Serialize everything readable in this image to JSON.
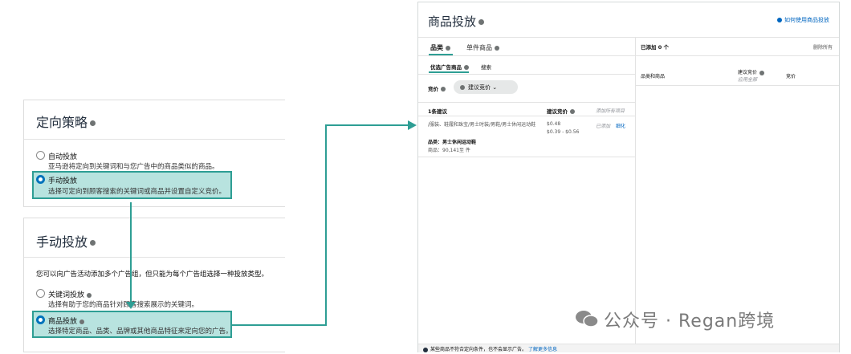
{
  "strategy_panel": {
    "title": "定向策略",
    "options": [
      {
        "label": "自动投放",
        "desc": "亚马逊将定向到关键词和与您广告中的商品类似的商品。",
        "selected": false
      },
      {
        "label": "手动投放",
        "desc": "选择可定向到顾客搜索的关键词或商品并设置自定义竞价。",
        "selected": true
      }
    ]
  },
  "manual_panel": {
    "title": "手动投放",
    "intro": "您可以向广告活动添加多个广告组，但只能为每个广告组选择一种投放类型。",
    "options": [
      {
        "label": "关键词投放",
        "desc": "选择有助于您的商品针对顾客搜索展示的关键词。",
        "selected": false
      },
      {
        "label": "商品投放",
        "desc": "选择特定商品、品类、品牌或其他商品特征来定向您的广告。",
        "selected": true
      }
    ]
  },
  "targeting_window": {
    "title": "商品投放",
    "help_link": "如何使用商品投放",
    "tabs": [
      "品类",
      "单件商品"
    ],
    "subtabs": [
      "优选广告商品",
      "搜索"
    ],
    "bid_label": "竞价",
    "bid_select": "建议竞价",
    "table_header": {
      "count": "1条建议",
      "bid": "建议竞价",
      "add_all": "添加所有项目"
    },
    "suggestion": {
      "path": "/服装、鞋履和珠宝/男士时装/男鞋/男士休闲运动鞋",
      "category": "品类：男士休闲运动鞋",
      "products": "商品：90,141至 件",
      "bid": "$0.48",
      "bid_range": "$0.39 - $0.56",
      "status": "已添加",
      "refine": "细化"
    },
    "added_count": "已添加 0 个",
    "remove_all": "删除所有",
    "added_cols": {
      "category": "品类和商品",
      "suggested_bid": "建议竞价",
      "apply_all": "应用全部",
      "bid": "竞价"
    },
    "footer_note": "某些商品不符合定向条件，也不会显示广告。",
    "footer_link": "了解更多信息"
  },
  "watermark": "公众号 · Regan跨境",
  "colors": {
    "accent": "#2e9e94",
    "link": "#0066c0",
    "highlight": "#b8e3df",
    "radio": "#0073bb"
  }
}
